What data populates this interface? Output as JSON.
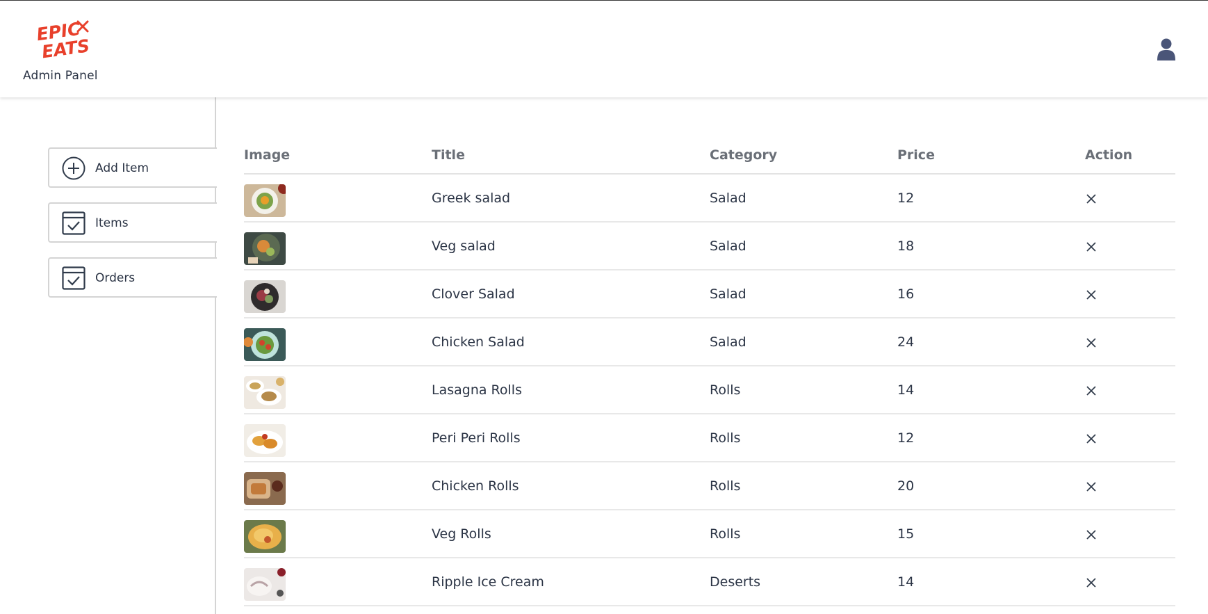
{
  "brand": {
    "logo_line1": "EPIC",
    "logo_line2": "EATS",
    "panel_label": "Admin Panel"
  },
  "header": {
    "profile_icon": "user-icon"
  },
  "sidebar": {
    "items": [
      {
        "label": "Add Item",
        "icon": "plus-circle-icon"
      },
      {
        "label": "Items",
        "icon": "calendar-check-icon"
      },
      {
        "label": "Orders",
        "icon": "calendar-check-icon"
      }
    ]
  },
  "table": {
    "headers": [
      "Image",
      "Title",
      "Category",
      "Price",
      "Action"
    ],
    "rows": [
      {
        "title": "Greek salad",
        "category": "Salad",
        "price": "12",
        "action": "×"
      },
      {
        "title": "Veg salad",
        "category": "Salad",
        "price": "18",
        "action": "×"
      },
      {
        "title": "Clover Salad",
        "category": "Salad",
        "price": "16",
        "action": "×"
      },
      {
        "title": "Chicken Salad",
        "category": "Salad",
        "price": "24",
        "action": "×"
      },
      {
        "title": "Lasagna Rolls",
        "category": "Rolls",
        "price": "14",
        "action": "×"
      },
      {
        "title": "Peri Peri Rolls",
        "category": "Rolls",
        "price": "12",
        "action": "×"
      },
      {
        "title": "Chicken Rolls",
        "category": "Rolls",
        "price": "20",
        "action": "×"
      },
      {
        "title": "Veg Rolls",
        "category": "Rolls",
        "price": "15",
        "action": "×"
      },
      {
        "title": "Ripple Ice Cream",
        "category": "Deserts",
        "price": "14",
        "action": "×"
      }
    ]
  },
  "colors": {
    "logo_red": "#e8402b",
    "text_dark": "#2b3445",
    "header_gray": "#6a6f77",
    "avatar": "#4a5578"
  }
}
